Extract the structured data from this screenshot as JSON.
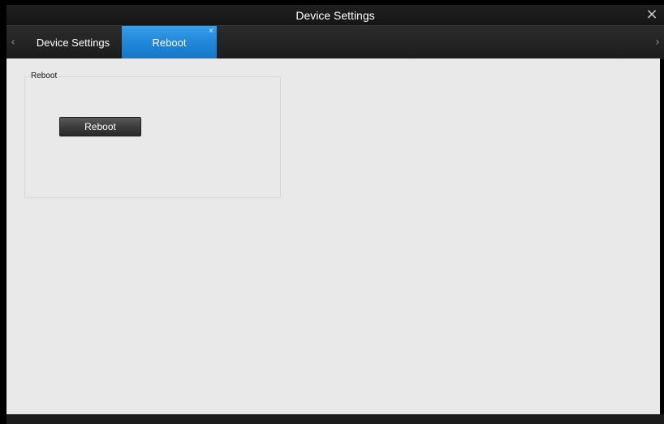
{
  "window": {
    "title": "Device Settings",
    "close_icon": "×"
  },
  "tabbar": {
    "left_arrow": "‹",
    "right_arrow": "›",
    "tabs": [
      {
        "label": "Device Settings",
        "active": false
      },
      {
        "label": "Reboot",
        "active": true,
        "close_icon": "×"
      }
    ]
  },
  "main": {
    "group_label": "Reboot",
    "reboot_button_label": "Reboot"
  },
  "colors": {
    "accent": "#1f86d8",
    "titlebar": "#1a1a1a",
    "content_bg": "#e9e9e9"
  }
}
